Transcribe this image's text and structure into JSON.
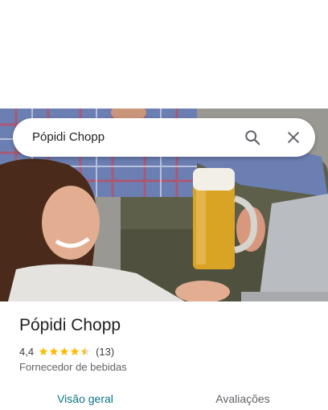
{
  "search": {
    "query": "Pópidi Chopp"
  },
  "place": {
    "name": "Pópidi Chopp",
    "rating": "4,4",
    "rating_value": 4.4,
    "review_count": "(13)",
    "category": "Fornecedor de bebidas"
  },
  "tabs": [
    {
      "label": "Visão geral",
      "active": true
    },
    {
      "label": "Avaliações",
      "active": false
    }
  ],
  "colors": {
    "accent": "#0b7285",
    "star": "#fbbc04"
  }
}
